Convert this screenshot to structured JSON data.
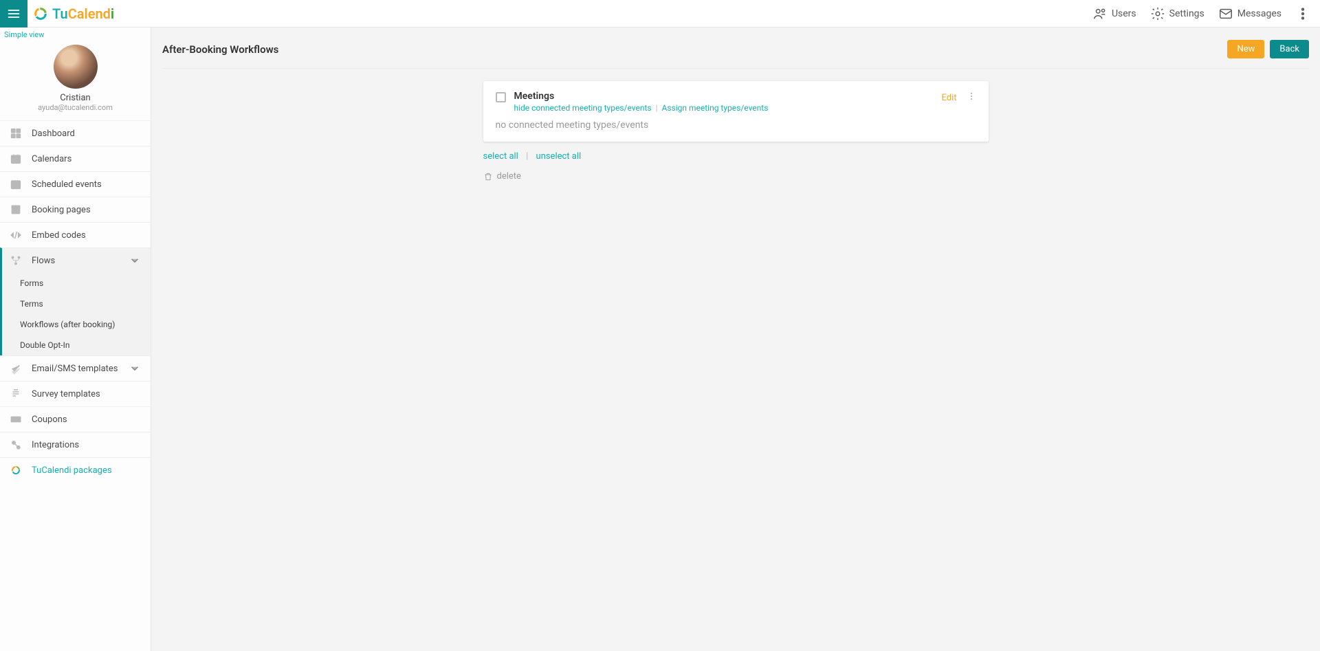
{
  "brand": {
    "prefix": "Tu",
    "mid": "Calend",
    "suffix": "i"
  },
  "topnav": {
    "users": "Users",
    "settings": "Settings",
    "messages": "Messages"
  },
  "sidebar": {
    "simple_view": "Simple view",
    "profile": {
      "name": "Cristian",
      "email": "ayuda@tucalendi.com"
    },
    "items": {
      "dashboard": "Dashboard",
      "calendars": "Calendars",
      "scheduled": "Scheduled events",
      "booking": "Booking pages",
      "embed": "Embed codes",
      "flows": "Flows",
      "flows_children": {
        "forms": "Forms",
        "terms": "Terms",
        "workflows": "Workflows (after booking)",
        "double": "Double Opt-In"
      },
      "templates": "Email/SMS templates",
      "survey": "Survey templates",
      "coupons": "Coupons",
      "integrations": "Integrations",
      "packages": "TuCalendi packages"
    }
  },
  "page": {
    "title": "After-Booking Workflows",
    "btn_new": "New",
    "btn_back": "Back"
  },
  "workflow": {
    "title": "Meetings",
    "hide_link": "hide connected meeting types/events",
    "assign_link": "Assign meeting types/events",
    "empty_msg": "no connected meeting types/events",
    "edit": "Edit"
  },
  "bulk": {
    "select_all": "select all",
    "unselect_all": "unselect all",
    "delete": "delete"
  }
}
